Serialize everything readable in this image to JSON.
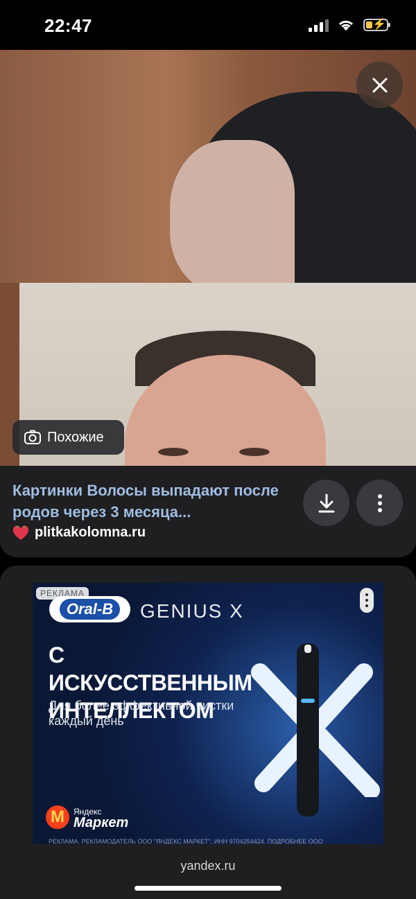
{
  "status_bar": {
    "time": "22:47"
  },
  "viewer": {
    "similar_label": "Похожие",
    "title": "Картинки Волосы выпадают после родов через 3 месяца...",
    "source": "plitkakolomna.ru"
  },
  "ad": {
    "badge": "РЕКЛАМА",
    "brand": "Oral-B",
    "product": "GENIUS X",
    "headline": "С ИСКУССТВЕННЫМ ИНТЕЛЛЕКТОМ",
    "subline": "Для более эффективной чистки каждый день",
    "market_small": "Яндекс",
    "market_big": "Маркет",
    "disclaimer": "РЕКЛАМА. РЕКЛАМОДАТЕЛЬ ООО \"ЯНДЕКС МАРКЕТ\", ИНН 9704254424. ПОДРОБНЕЕ ООО"
  },
  "browser": {
    "url": "yandex.ru"
  },
  "colors": {
    "link": "#9fbde0",
    "card": "#1f1f22",
    "button": "#3a3a3e"
  }
}
